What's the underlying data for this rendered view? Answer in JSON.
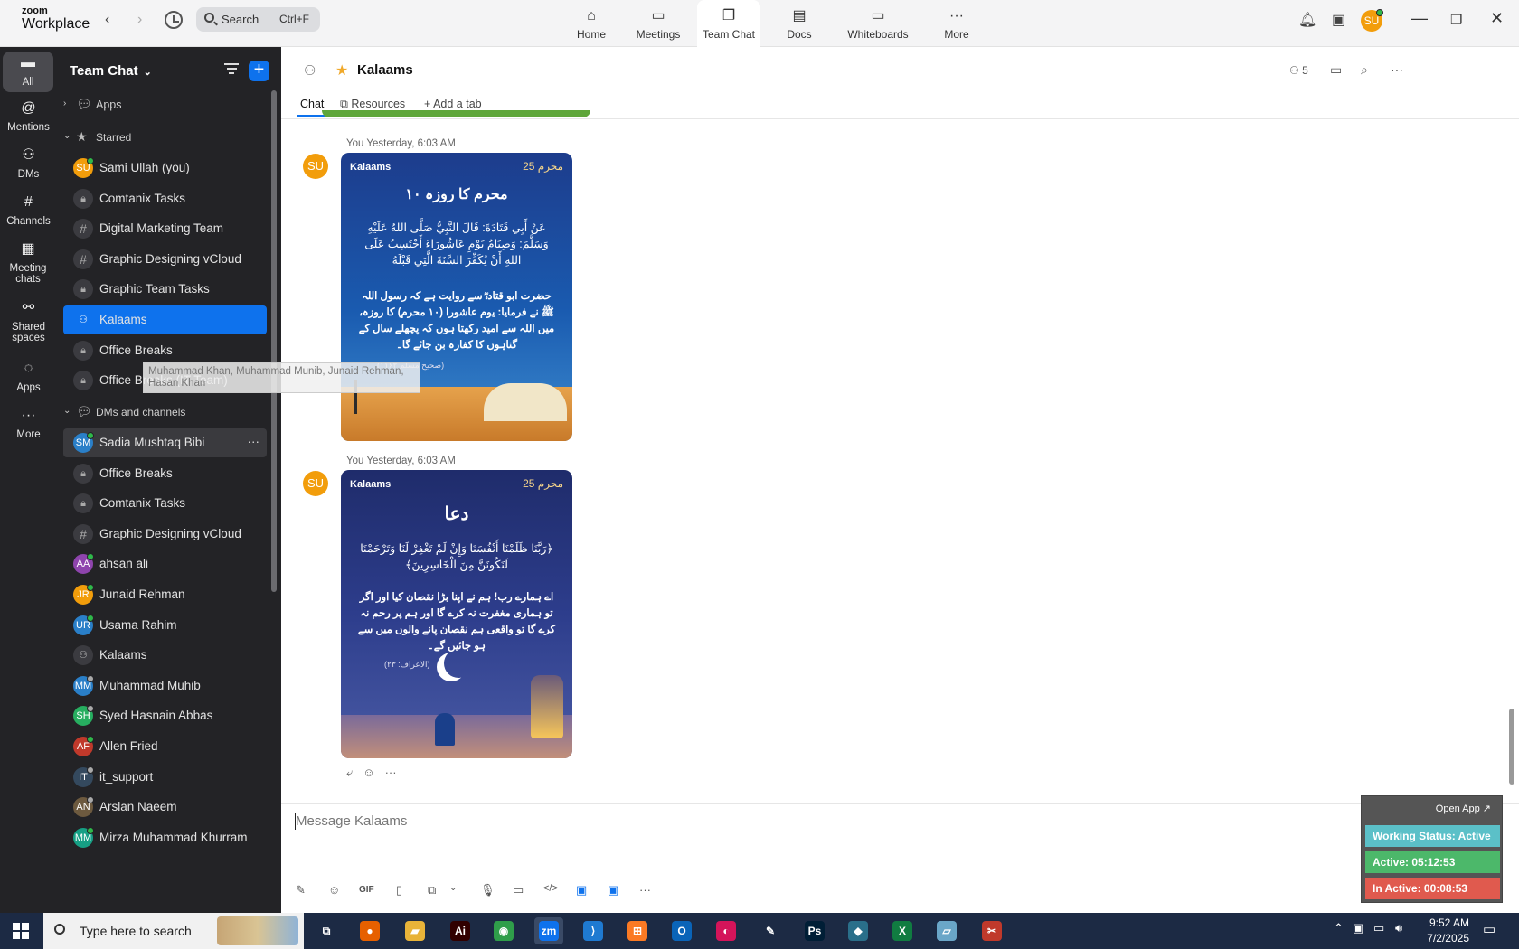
{
  "app": {
    "brand_top": "zoom",
    "brand_bottom": "Workplace"
  },
  "search": {
    "label": "Search",
    "shortcut": "Ctrl+F"
  },
  "topnav": [
    {
      "label": "Home",
      "icon": "home-icon",
      "glyph": "⌂"
    },
    {
      "label": "Meetings",
      "icon": "video-icon",
      "glyph": "▭"
    },
    {
      "label": "Team Chat",
      "icon": "chat-icon",
      "glyph": "❐"
    },
    {
      "label": "Docs",
      "icon": "doc-icon",
      "glyph": "▤"
    },
    {
      "label": "Whiteboards",
      "icon": "whiteboard-icon",
      "glyph": "▭"
    },
    {
      "label": "More",
      "icon": "more-icon",
      "glyph": "···"
    }
  ],
  "user": {
    "initials": "SU",
    "color": "#f29d0b"
  },
  "rail": [
    {
      "label": "All",
      "glyph": "▬",
      "icon": "all-chat-icon"
    },
    {
      "label": "Mentions",
      "glyph": "@",
      "icon": "mentions-icon"
    },
    {
      "label": "DMs",
      "glyph": "⚇",
      "icon": "dms-icon"
    },
    {
      "label": "Channels",
      "glyph": "#",
      "icon": "channels-icon"
    },
    {
      "label": "Meeting chats",
      "glyph": "▦",
      "icon": "meeting-chats-icon"
    },
    {
      "label": "Shared spaces",
      "glyph": "⚯",
      "icon": "shared-spaces-icon"
    },
    {
      "label": "Apps",
      "glyph": "◌",
      "icon": "apps-icon"
    },
    {
      "label": "More",
      "glyph": "···",
      "icon": "more-icon"
    }
  ],
  "sidebar": {
    "title": "Team Chat",
    "sections": {
      "apps": "Apps",
      "starred": "Starred",
      "dms": "DMs and channels"
    },
    "starred": [
      {
        "name": "Sami Ullah (you)",
        "type": "avatar",
        "initials": "SU",
        "color": "#f29d0b",
        "status": "online"
      },
      {
        "name": "Comtanix Tasks",
        "type": "lock"
      },
      {
        "name": "Digital Marketing Team",
        "type": "hash"
      },
      {
        "name": "Graphic Designing vCloud",
        "type": "hash"
      },
      {
        "name": "Graphic Team Tasks",
        "type": "lock"
      },
      {
        "name": "Kalaams",
        "type": "group",
        "active": true
      },
      {
        "name": "Office Breaks",
        "type": "lock"
      },
      {
        "name": "Office Breaks (IT Team)",
        "type": "lock"
      }
    ],
    "dms": [
      {
        "name": "Sadia Mushtaq Bibi",
        "type": "avatar",
        "initials": "SM",
        "color": "#2a7fc8",
        "status": "online",
        "hover": true
      },
      {
        "name": "Office Breaks",
        "type": "lock"
      },
      {
        "name": "Comtanix Tasks",
        "type": "lock"
      },
      {
        "name": "Graphic Designing vCloud",
        "type": "hash"
      },
      {
        "name": "ahsan ali",
        "type": "avatar",
        "initials": "AA",
        "color": "#8e44ad",
        "status": "online"
      },
      {
        "name": "Junaid Rehman",
        "type": "avatar",
        "initials": "JR",
        "color": "#f29d0b",
        "status": "online"
      },
      {
        "name": "Usama Rahim",
        "type": "avatar",
        "initials": "UR",
        "color": "#2a7fc8",
        "status": "online"
      },
      {
        "name": "Kalaams",
        "type": "group"
      },
      {
        "name": "Muhammad Muhib",
        "type": "avatar",
        "initials": "MM",
        "color": "#2a7fc8",
        "status": "away"
      },
      {
        "name": "Syed Hasnain Abbas",
        "type": "avatar",
        "initials": "SH",
        "color": "#27ae60",
        "status": "away"
      },
      {
        "name": "Allen Fried",
        "type": "avatar",
        "initials": "AF",
        "color": "#c0392b",
        "status": "online"
      },
      {
        "name": "it_support",
        "type": "avatar",
        "initials": "IT",
        "color": "#34495e",
        "status": "away"
      },
      {
        "name": "Arslan Naeem",
        "type": "avatar",
        "initials": "AN",
        "color": "#6d5a3f",
        "status": "away"
      },
      {
        "name": "Mirza Muhammad Khurram",
        "type": "avatar",
        "initials": "MM",
        "color": "#16a085",
        "status": "online"
      }
    ],
    "tooltip": "Muhammad Khan, Muhammad Munib, Junaid Rehman, Hasan Khan"
  },
  "channel": {
    "name": "Kalaams",
    "members": "5",
    "tabs": [
      "Chat",
      "Resources",
      "Add a tab"
    ]
  },
  "messages": [
    {
      "sender": "You",
      "time": "Yesterday, 6:03 AM",
      "avatar": "SU",
      "card": {
        "brand": "Kalaams",
        "badge": "محرم 25",
        "title": "۱۰ محرم کا روزہ",
        "arabic": "عَنْ أَبِي قَتَادَةَ: قَالَ النَّبِيُّ صَلَّى اللهُ عَلَيْهِ وَسَلَّمَ: وَصِيَامُ يَوْمِ عَاشُورَاءَ أَحْتَسِبُ عَلَى اللهِ أَنْ يُكَفِّرَ السَّنَةَ الَّتِي قَبْلَهُ",
        "urdu": "حضرت ابو قتادہؓ سے روایت ہے کہ رسول اللہ ﷺ نے فرمایا: یوم عاشورا (۱۰ محرم) کا روزہ، میں اللہ سے امید رکھتا ہوں کہ پچھلے سال کے گناہوں کا کفارہ بن جائے گا۔",
        "ref": "(صحیح مسلم ۱۱۶۲)"
      }
    },
    {
      "sender": "You",
      "time": "Yesterday, 6:03 AM",
      "avatar": "SU",
      "card": {
        "brand": "Kalaams",
        "badge": "محرم 25",
        "title": "دعا",
        "arabic": "﴿رَبَّنَا ظَلَمْنَا أَنْفُسَنَا وَإِنْ لَمْ تَغْفِرْ لَنَا وَتَرْحَمْنَا لَنَكُونَنَّ مِنَ الْخَاسِرِينَ﴾",
        "urdu": "اے ہمارے رب! ہم نے اپنا بڑا نقصان کیا اور اگر تو ہماری مغفرت نہ کرے گا اور ہم پر رحم نہ کرے گا تو واقعی ہم نقصان پانے والوں میں سے ہو جائیں گے۔",
        "ref": "(الاعراف: ۲۳)"
      }
    }
  ],
  "composer": {
    "placeholder": "Message Kalaams",
    "gif": "GIF"
  },
  "widget": {
    "open": "Open App ↗",
    "status": "Working Status: Active",
    "active": "Active: 05:12:53",
    "inactive": "In Active: 00:08:53",
    "colors": {
      "status": "#5bc0c8",
      "active": "#4cb86a",
      "inactive": "#e05a4e"
    }
  },
  "taskbar": {
    "search": "Type here to search",
    "time": "9:52 AM",
    "date": "7/2/2025",
    "apps": [
      {
        "label": "⧉",
        "name": "task-view-icon",
        "bg": "transparent"
      },
      {
        "label": "●",
        "name": "firefox-icon",
        "bg": "#e66000"
      },
      {
        "label": "▰",
        "name": "file-explorer-icon",
        "bg": "#e8b339"
      },
      {
        "label": "Ai",
        "name": "illustrator-icon",
        "bg": "#310000"
      },
      {
        "label": "◉",
        "name": "chrome-icon",
        "bg": "#2f9e4a"
      },
      {
        "label": "zm",
        "name": "zoom-taskbar-icon",
        "bg": "#0e72ed"
      },
      {
        "label": "⟩",
        "name": "vscode-icon",
        "bg": "#1f7ad1"
      },
      {
        "label": "⊞",
        "name": "xampp-icon",
        "bg": "#fb7a24"
      },
      {
        "label": "O",
        "name": "outlook-icon",
        "bg": "#0a64b8"
      },
      {
        "label": "◐",
        "name": "creative-cloud-icon",
        "bg": "#d4145a"
      },
      {
        "label": "✎",
        "name": "pen-tool-icon",
        "bg": "transparent"
      },
      {
        "label": "Ps",
        "name": "photoshop-icon",
        "bg": "#001e36"
      },
      {
        "label": "◆",
        "name": "app-diamond-icon",
        "bg": "#2a6f8a"
      },
      {
        "label": "X",
        "name": "excel-icon",
        "bg": "#107c41"
      },
      {
        "label": "▱",
        "name": "notes-icon",
        "bg": "#6aa6c8"
      },
      {
        "label": "✂",
        "name": "snip-icon",
        "bg": "#c0392b"
      }
    ]
  }
}
